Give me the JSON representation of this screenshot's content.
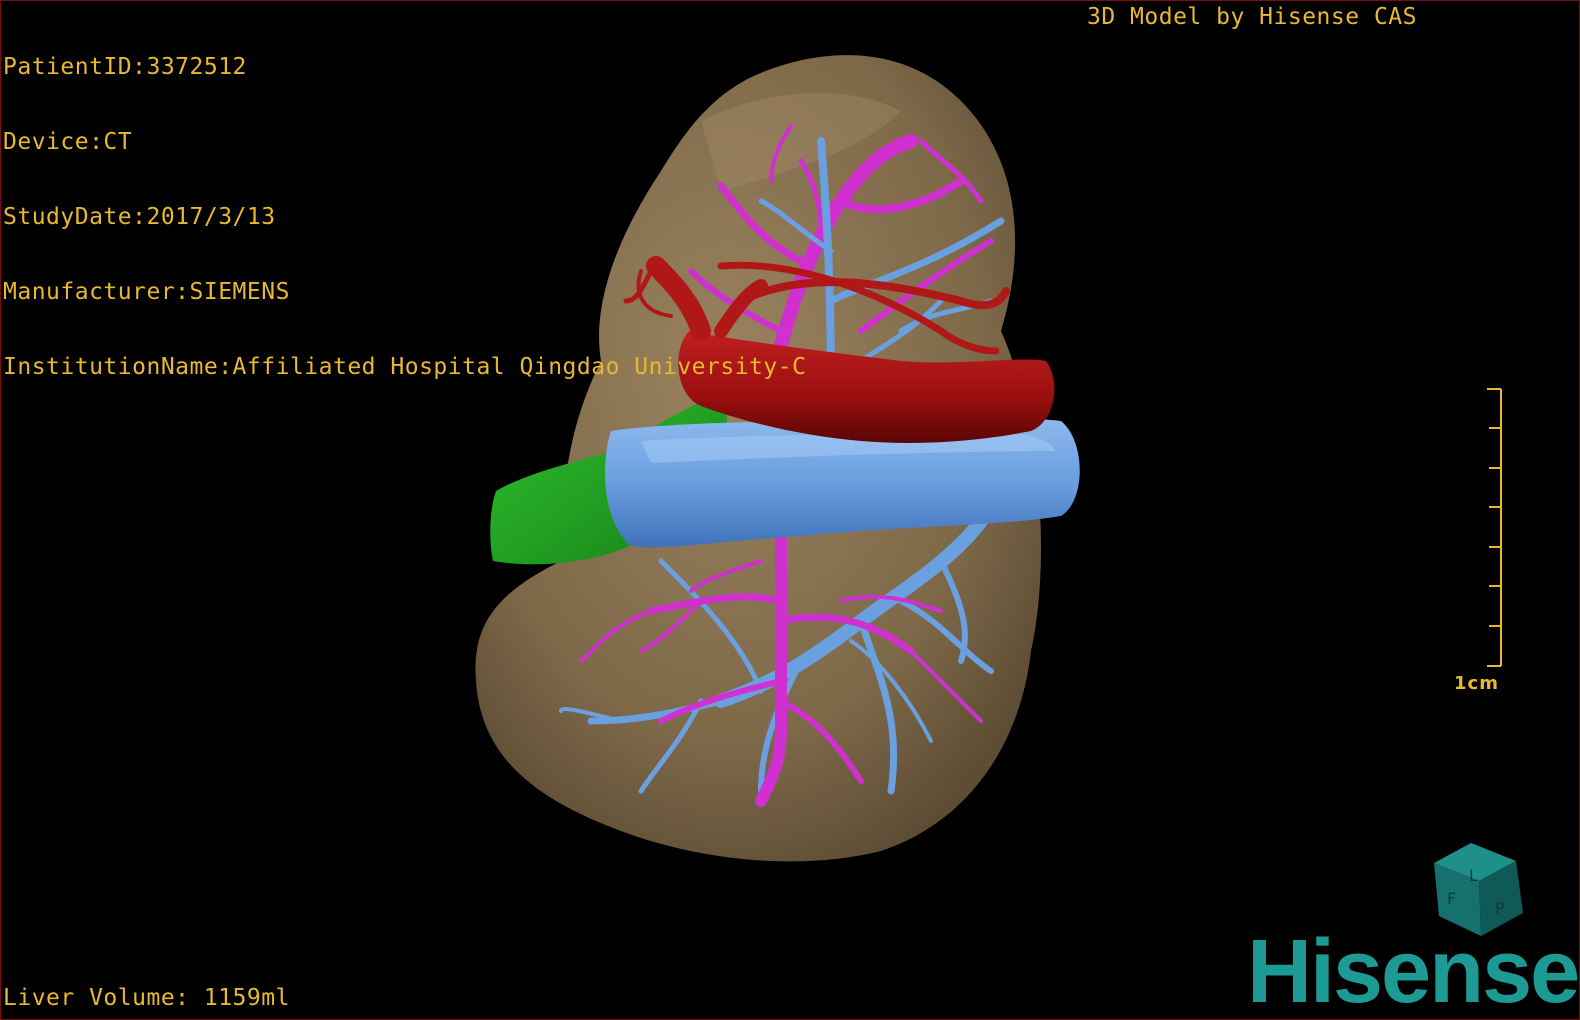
{
  "patient": {
    "id_line": "PatientID:3372512",
    "device_line": "Device:CT",
    "study_date_line": "StudyDate:2017/3/13",
    "manufacturer_line": "Manufacturer:SIEMENS",
    "institution_line": "InstitutionName:Affiliated Hospital Qingdao University-C"
  },
  "credit": "3D Model by Hisense CAS",
  "liver_volume": "Liver Volume: 1159ml",
  "scale_bar": {
    "label": "1cm"
  },
  "orientation_cube": {
    "faces": [
      "F",
      "L",
      "P"
    ]
  },
  "brand": "Hisense",
  "colors": {
    "overlay_text": "#e8b830",
    "liver": "#8a7350",
    "portal_vein": "#6aa0e0",
    "hepatic_vein": "#d030d0",
    "artery": "#a01010",
    "gallbladder": "#20a020",
    "brand": "#1e9a95"
  }
}
